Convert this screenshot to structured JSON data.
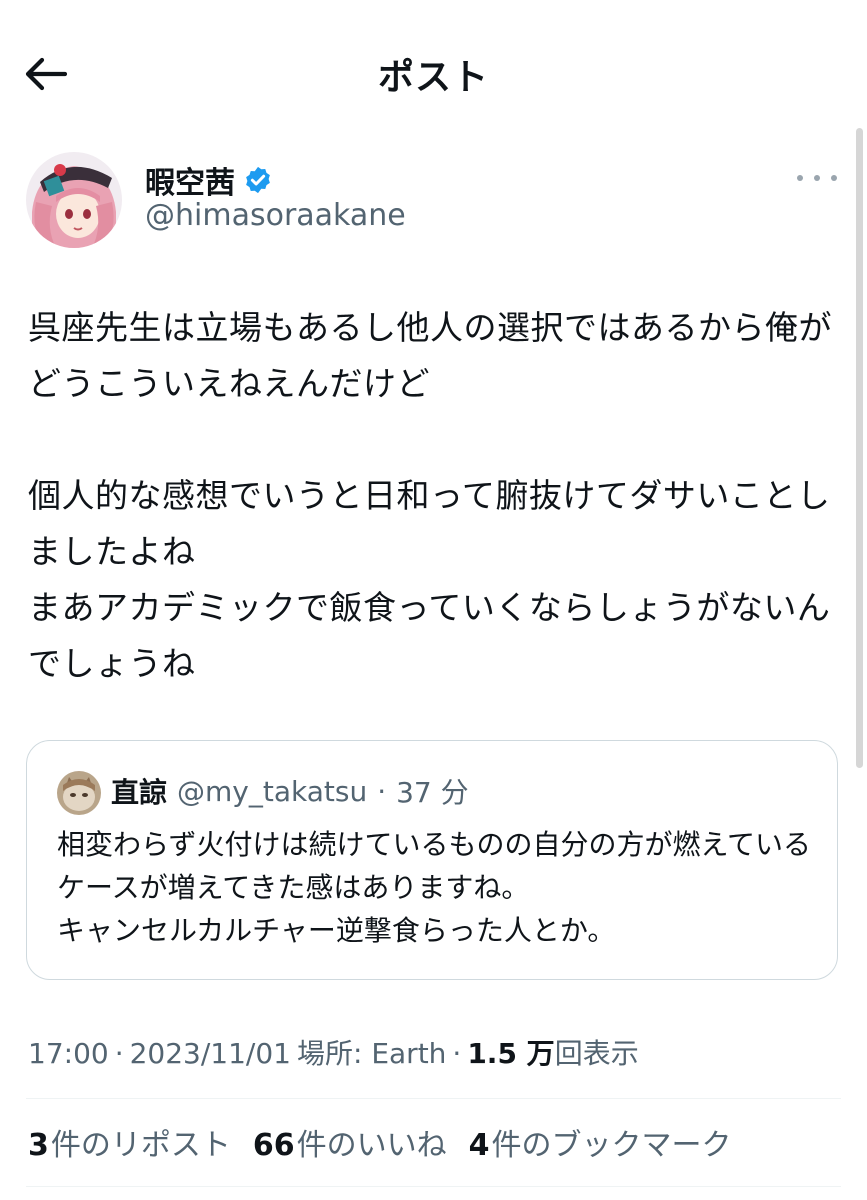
{
  "header": {
    "title": "ポスト"
  },
  "author": {
    "display_name": "暇空茜",
    "handle": "@himasoraakane"
  },
  "tweet": {
    "text": "呉座先生は立場もあるし他人の選択ではあるから俺がどうこういえねえんだけど\n\n個人的な感想でいうと日和って腑抜けてダサいことしましたよね\nまあアカデミックで飯食っていくならしょうがないんでしょうね"
  },
  "quote": {
    "display_name": "直諒",
    "handle": "@my_takatsu",
    "separator": "·",
    "time": "37 分",
    "text": "相変わらず火付けは続けているものの自分の方が燃えているケースが増えてきた感はありますね。\nキャンセルカルチャー逆撃食らった人とか。"
  },
  "meta": {
    "time": "17:00",
    "sep1": "·",
    "date": "2023/11/01",
    "location": "場所: Earth",
    "sep2": "·",
    "views_count": "1.5 万",
    "views_label": "回表示"
  },
  "stats": {
    "reposts_count": "3",
    "reposts_label": "件のリポスト",
    "likes_count": "66",
    "likes_label": "件のいいね",
    "bookmarks_count": "4",
    "bookmarks_label": "件のブックマーク"
  },
  "colors": {
    "verified": "#1d9bf0",
    "secondary_text": "#536471",
    "border": "#cfd9de"
  },
  "icons": [
    "back-arrow-icon",
    "verified-badge-icon",
    "more-icon"
  ]
}
